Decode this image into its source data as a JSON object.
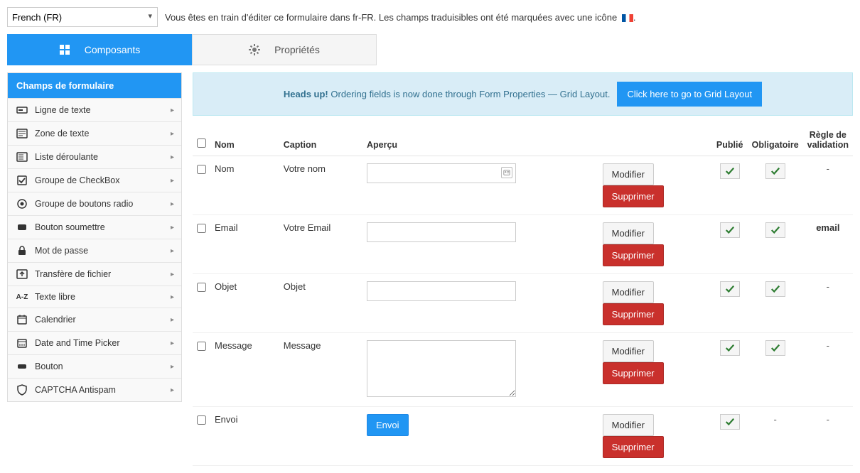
{
  "language": {
    "selected": "French (FR)",
    "editingText": "Vous êtes en train d'éditer ce formulaire dans fr-FR. Les champs traduisibles ont été marquées avec une icône"
  },
  "tabs": {
    "components": "Composants",
    "properties": "Propriétés"
  },
  "sidebar": {
    "header": "Champs de formulaire",
    "items": [
      {
        "label": "Ligne de texte",
        "icon": "text-line"
      },
      {
        "label": "Zone de texte",
        "icon": "textarea"
      },
      {
        "label": "Liste déroulante",
        "icon": "dropdown"
      },
      {
        "label": "Groupe de CheckBox",
        "icon": "checkbox"
      },
      {
        "label": "Groupe de boutons radio",
        "icon": "radio"
      },
      {
        "label": "Bouton soumettre",
        "icon": "submit"
      },
      {
        "label": "Mot de passe",
        "icon": "password"
      },
      {
        "label": "Transfère de fichier",
        "icon": "upload"
      },
      {
        "label": "Texte libre",
        "icon": "freetext"
      },
      {
        "label": "Calendrier",
        "icon": "calendar"
      },
      {
        "label": "Date and Time Picker",
        "icon": "datetime"
      },
      {
        "label": "Bouton",
        "icon": "button"
      },
      {
        "label": "CAPTCHA Antispam",
        "icon": "captcha"
      }
    ]
  },
  "alert": {
    "headsUp": "Heads up!",
    "text": "Ordering fields is now done through Form Properties — Grid Layout.",
    "button": "Click here to go to Grid Layout"
  },
  "table": {
    "headers": {
      "name": "Nom",
      "caption": "Caption",
      "preview": "Aperçu",
      "published": "Publié",
      "required": "Obligatoire",
      "validation": "Règle de validation"
    },
    "actions": {
      "edit": "Modifier",
      "delete": "Supprimer"
    },
    "rows": [
      {
        "name": "Nom",
        "caption": "Votre nom",
        "preview_type": "text_badge",
        "published": true,
        "required": true,
        "validation": "-"
      },
      {
        "name": "Email",
        "caption": "Votre Email",
        "preview_type": "text",
        "published": true,
        "required": true,
        "validation": "email"
      },
      {
        "name": "Objet",
        "caption": "Objet",
        "preview_type": "text",
        "published": true,
        "required": true,
        "validation": "-"
      },
      {
        "name": "Message",
        "caption": "Message",
        "preview_type": "textarea",
        "published": true,
        "required": true,
        "validation": "-"
      },
      {
        "name": "Envoi",
        "caption": "",
        "preview_type": "submit",
        "preview_label": "Envoi",
        "published": true,
        "required": null,
        "validation": "-"
      }
    ]
  }
}
